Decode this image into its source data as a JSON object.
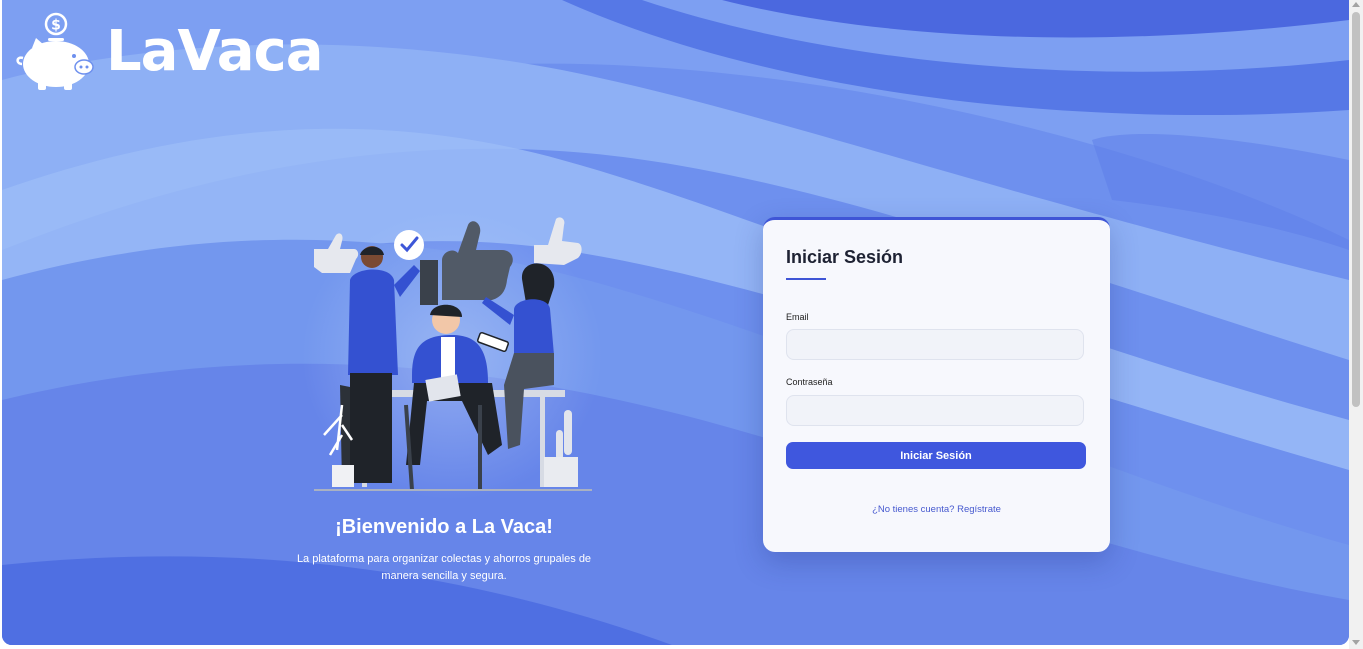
{
  "brand": {
    "name": "LaVaca",
    "logo_icon": "piggy-bank-dollar-icon"
  },
  "hero": {
    "title": "¡Bienvenido a La Vaca!",
    "description": "La plataforma para organizar colectas y ahorros grupales de manera sencilla y segura.",
    "illustration": "team-thumbs-up-illustration"
  },
  "login": {
    "title": "Iniciar Sesión",
    "email_label": "Email",
    "email_value": "",
    "password_label": "Contraseña",
    "password_value": "",
    "submit_label": "Iniciar Sesión",
    "register_link": "¿No tienes cuenta? Regístrate"
  },
  "colors": {
    "accent": "#3f57de",
    "background": "#5a7fe8",
    "card": "#f7f8fd",
    "text_dark": "#1e2233"
  }
}
